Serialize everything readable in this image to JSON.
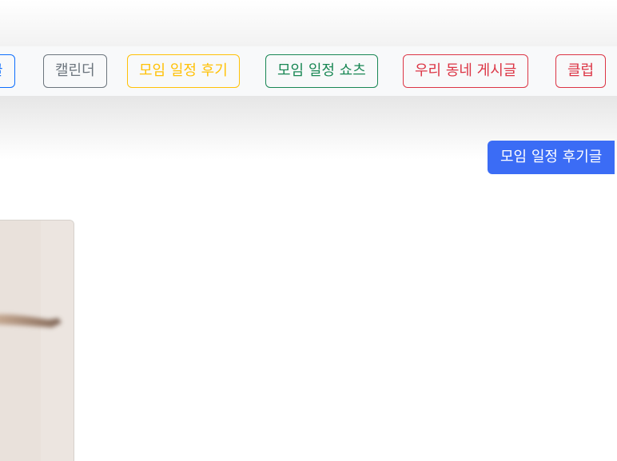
{
  "category_nav": {
    "items": [
      {
        "label": "글",
        "color": "#0d6efd"
      },
      {
        "label": "캘린더",
        "color": "#6c757d"
      },
      {
        "label": "모임 일정 후기",
        "color": "#ffc107"
      },
      {
        "label": "모임 일정 쇼츠",
        "color": "#198754"
      },
      {
        "label": "우리 동네 게시글",
        "color": "#dc3545"
      },
      {
        "label": "클럽",
        "color": "#dc3545"
      }
    ]
  },
  "actions": {
    "write_review_label": "모임 일정 후기글"
  },
  "colors": {
    "primary": "#3b6cf5",
    "nav_background": "#f8f9fa"
  }
}
